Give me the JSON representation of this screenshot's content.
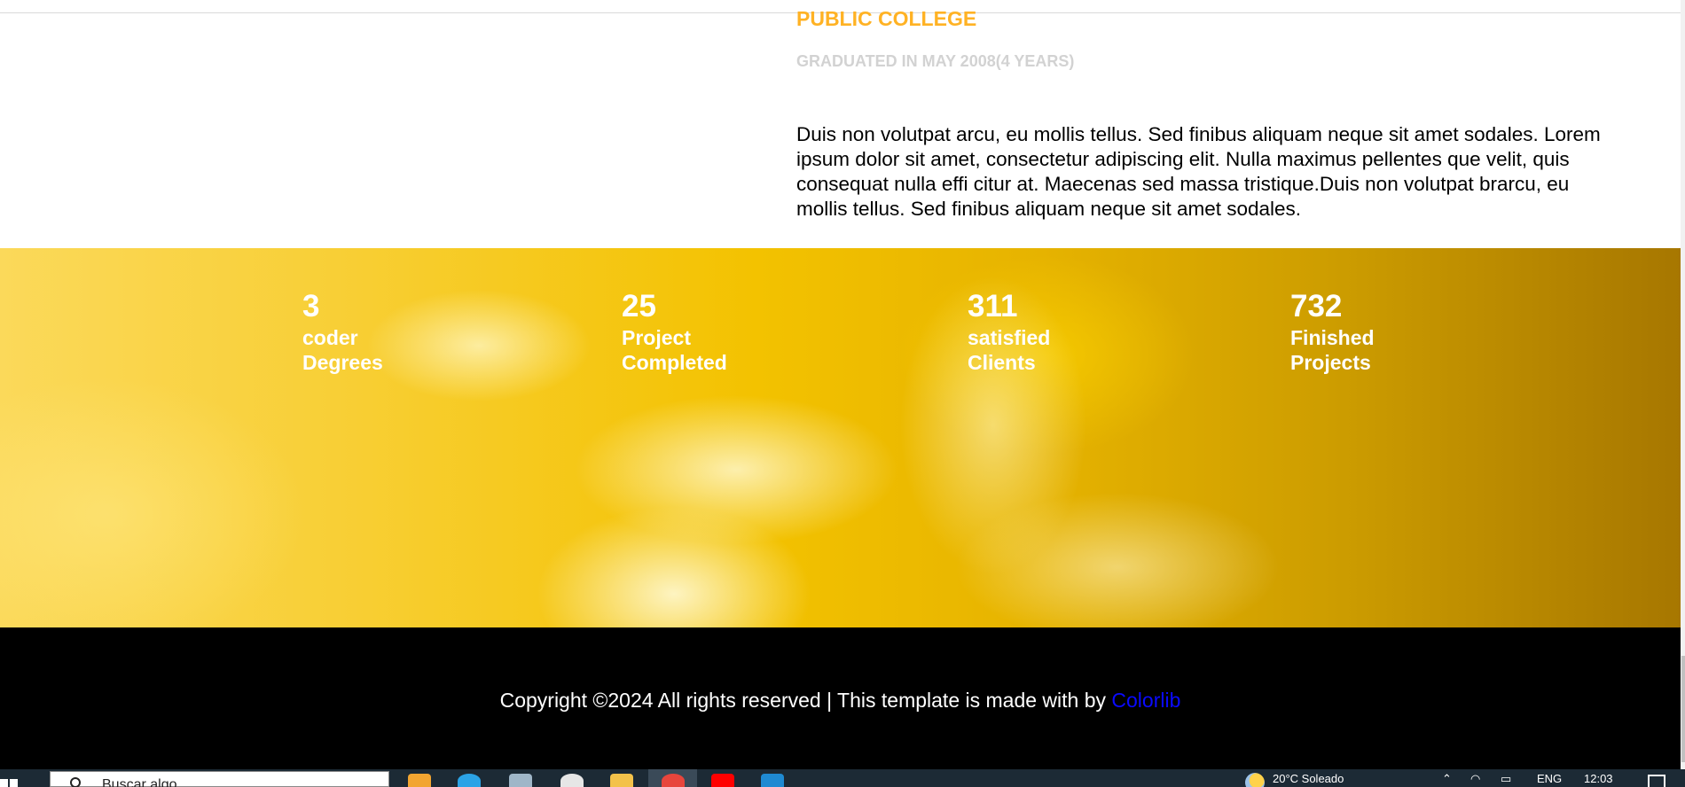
{
  "education": {
    "school": "PUBLIC COLLEGE",
    "graduated": "GRADUATED IN MAY 2008(4 YEARS)",
    "description": "Duis non volutpat arcu, eu mollis tellus. Sed finibus aliquam neque sit amet sodales. Lorem ipsum dolor sit amet, consectetur adipiscing elit. Nulla maximus pellentes que velit, quis consequat nulla effi citur at. Maecenas sed massa tristique.Duis non volutpat brarcu, eu mollis tellus. Sed finibus aliquam neque sit amet sodales."
  },
  "stats": [
    {
      "number": "3",
      "line1": "coder",
      "line2": "Degrees"
    },
    {
      "number": "25",
      "line1": "Project",
      "line2": "Completed"
    },
    {
      "number": "311",
      "line1": "satisfied",
      "line2": "Clients"
    },
    {
      "number": "732",
      "line1": "Finished",
      "line2": "Projects"
    }
  ],
  "footer": {
    "copyright": "Copyright ©2024 All rights reserved | This template is made with by ",
    "link_text": "Colorlib"
  },
  "taskbar": {
    "search_placeholder": "Buscar algo",
    "weather": "20°C  Soleado",
    "language": "ENG",
    "clock": "12:03"
  },
  "colors": {
    "accent": "#ffb224",
    "muted": "#d2d2d2",
    "link": "#0a0aff",
    "footer_bg": "#000000",
    "taskbar_bg": "#1c2a35"
  }
}
